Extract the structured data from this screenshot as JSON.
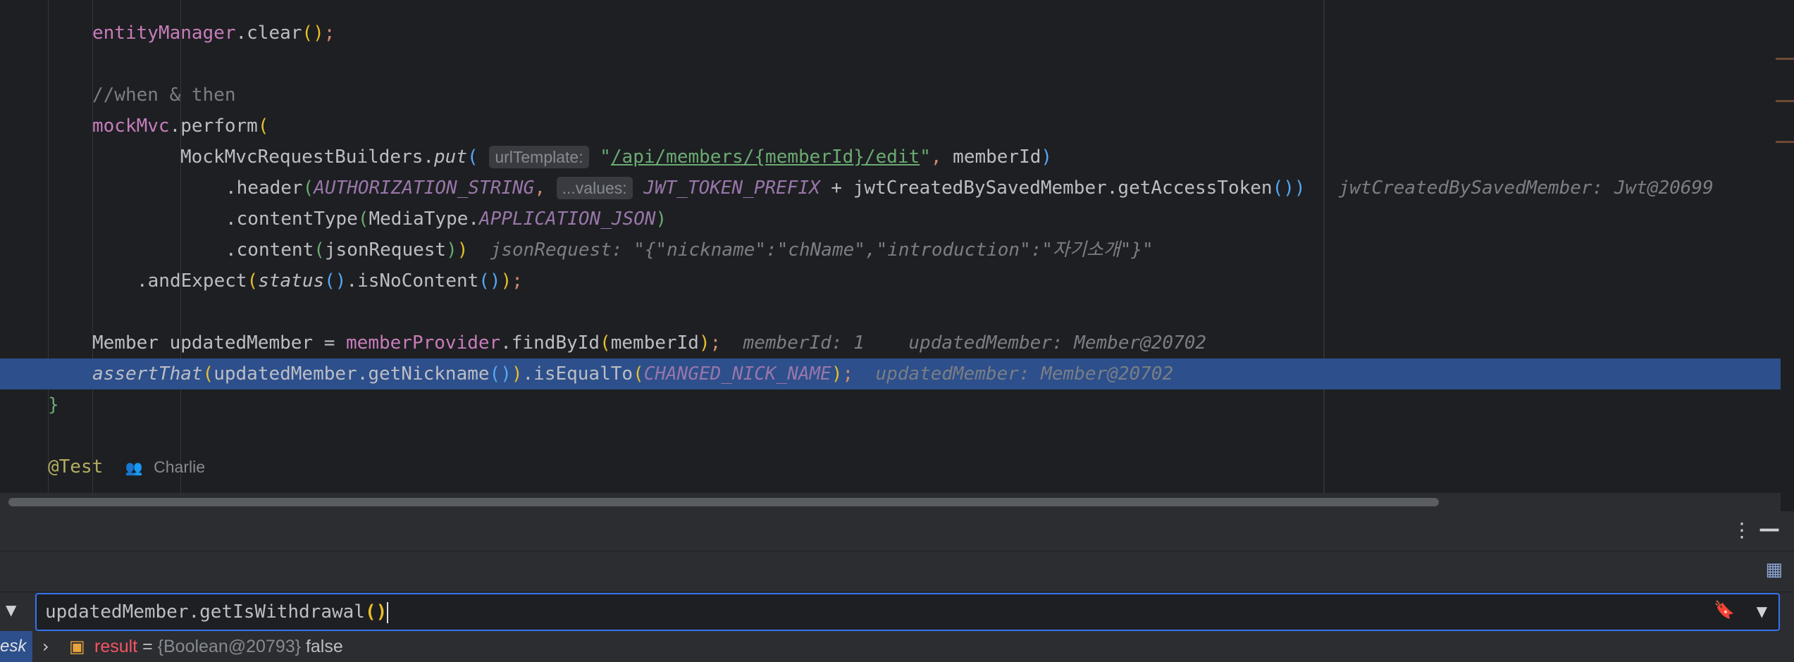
{
  "editor": {
    "lines": {
      "l1": {
        "obj": "entityManager",
        "method": ".clear"
      },
      "l3": {
        "comment": "//when & then"
      },
      "l4": {
        "obj": "mockMvc",
        "method": ".perform"
      },
      "l5": {
        "cls": "MockMvcRequestBuilders.",
        "method": "put",
        "hint": "urlTemplate:",
        "url": "/api/members/{memberId}/edit",
        "arg": " memberId"
      },
      "l6": {
        "method": ".header",
        "const": "AUTHORIZATION_STRING",
        "hint": "...values:",
        "const2": "JWT_TOKEN_PREFIX",
        "plus": " + jwtCreatedBySavedMember.getAccessToken",
        "inline": "jwtCreatedBySavedMember: Jwt@20699"
      },
      "l7": {
        "method": ".contentType",
        "cls": "MediaType.",
        "const": "APPLICATION_JSON"
      },
      "l8": {
        "method": ".content",
        "arg": "jsonRequest",
        "inline": "jsonRequest: \"{\"nickname\":\"chName\",\"introduction\":\"자기소개\"}\""
      },
      "l9": {
        "method": ".andExpect",
        "status": "status",
        "method2": ".isNoContent"
      },
      "l11": {
        "decl": "Member updatedMember = ",
        "obj": "memberProvider",
        "method": ".findById",
        "arg": "memberId",
        "inline1": "memberId: 1",
        "inline2": "updatedMember: Member@20702"
      },
      "l12": {
        "assert": "assertThat",
        "obj": "updatedMember.getNickname",
        "method": ".isEqualTo",
        "const": "CHANGED_NICK_NAME",
        "inline": "updatedMember: Member@20702"
      },
      "l13": {
        "brace": "}"
      },
      "l15": {
        "annotation": "@Test",
        "author": "Charlie"
      }
    }
  },
  "debugger": {
    "expression": "updatedMember.getIsWithdrawal",
    "expression_parens": "()",
    "side_label": "esk",
    "result": {
      "name": "result",
      "eq": " = ",
      "type": "{Boolean@20793}",
      "value": "false"
    }
  },
  "icons": {
    "more": "more-vertical-icon",
    "minimize": "minimize-icon",
    "layout": "layout-icon",
    "dropdown": "dropdown-arrow-icon",
    "bookmark": "bookmark-icon",
    "expand": "chevron-right-icon",
    "object": "object-icon",
    "people": "people-icon"
  },
  "colors": {
    "highlight": "#2d4f8b",
    "accent": "#3574f0",
    "result_name": "#f75464"
  }
}
